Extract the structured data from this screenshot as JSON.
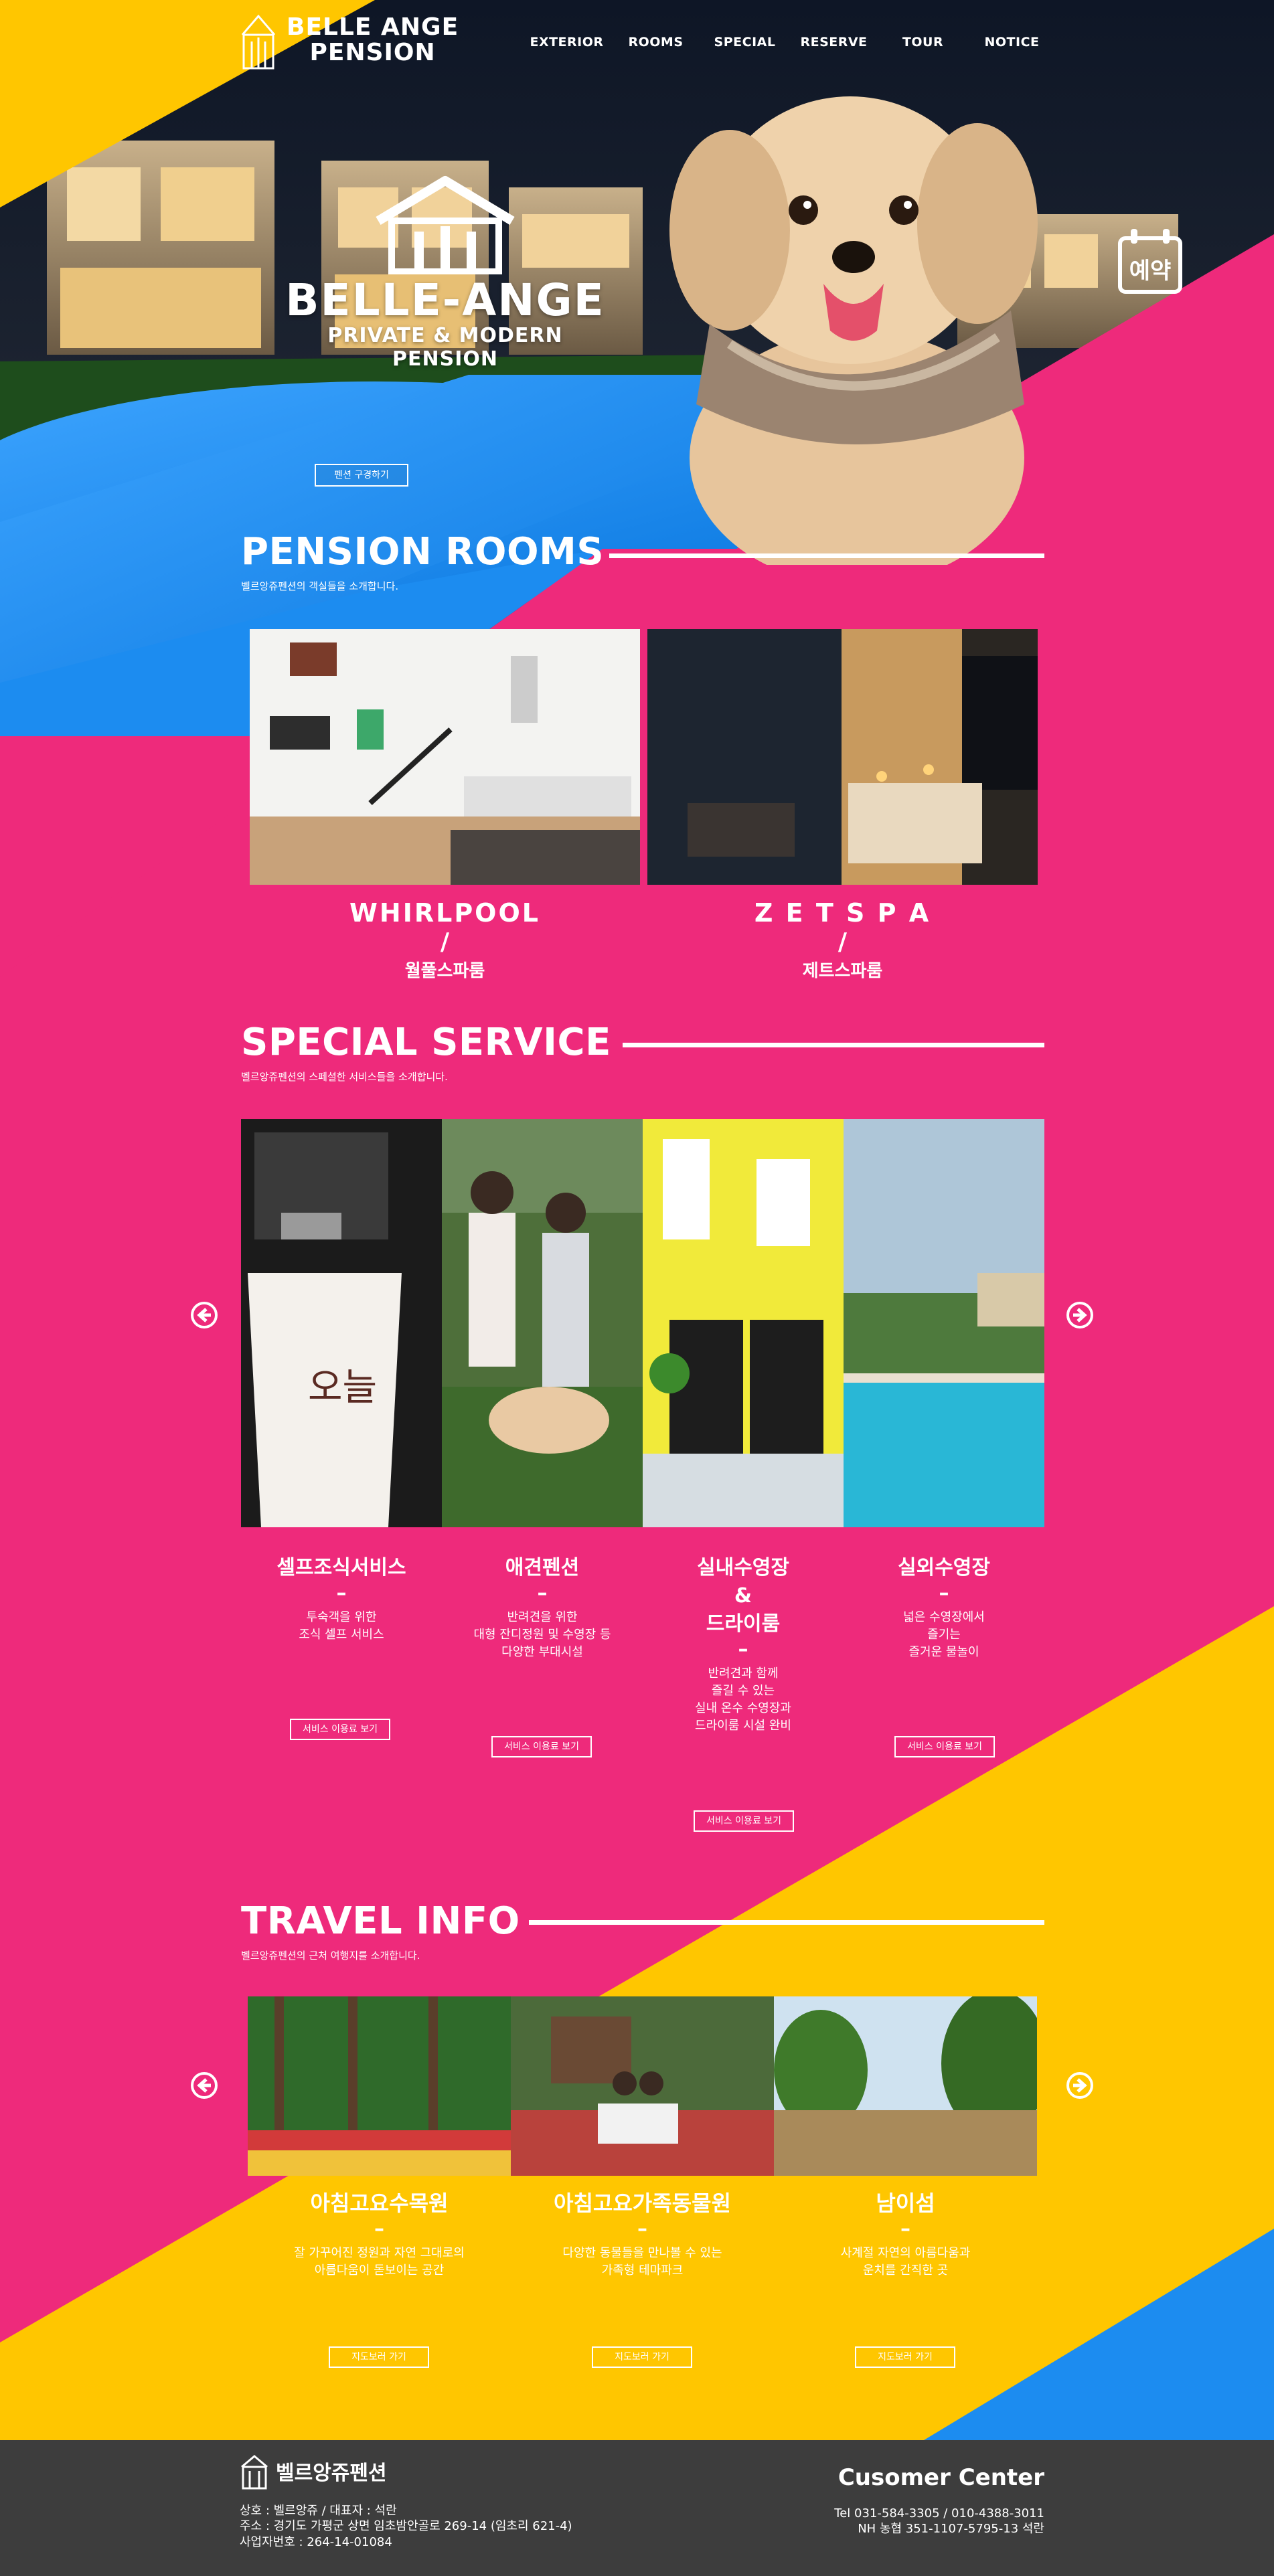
{
  "brand": {
    "line1": "BELLE ANGE",
    "line2": "PENSION"
  },
  "nav": {
    "items": [
      "EXTERIOR",
      "ROOMS",
      "SPECIAL",
      "RESERVE",
      "TOUR",
      "NOTICE"
    ]
  },
  "hero": {
    "title": "BELLE-ANGE",
    "subtitle": "PRIVATE & MODERN PENSION",
    "button": "펜션 구경하기",
    "reserve": "예약"
  },
  "rooms": {
    "title": "PENSION ROOMS",
    "desc": "벨르앙쥬펜션의 객실들을 소개합니다.",
    "items": [
      {
        "en": "WHIRLPOOL",
        "sep": "/",
        "ko": "월풀스파룸"
      },
      {
        "en": "Z E T S P A",
        "sep": "/",
        "ko": "제트스파룸"
      }
    ]
  },
  "special": {
    "title": "SPECIAL SERVICE",
    "desc": "벨르앙쥬펜션의 스페셜한 서비스들을 소개합니다.",
    "button": "서비스 이용료 보기",
    "items": [
      {
        "title": "셀프조식서비스",
        "title2": "",
        "title3": "",
        "dash": "–",
        "lines": [
          "투숙객을 위한",
          "조식 셀프 서비스"
        ]
      },
      {
        "title": "애견펜션",
        "title2": "",
        "title3": "",
        "dash": "–",
        "lines": [
          "반려견을 위한",
          "대형 잔디정원 및 수영장 등",
          "다양한 부대시설"
        ]
      },
      {
        "title": "실내수영장",
        "title2": "&",
        "title3": "드라이룸",
        "dash": "–",
        "lines": [
          "반려견과 함께",
          "즐길 수 있는",
          "실내 온수 수영장과",
          "드라이룸 시설 완비"
        ]
      },
      {
        "title": "실외수영장",
        "title2": "",
        "title3": "",
        "dash": "–",
        "lines": [
          "넓은 수영장에서",
          "즐기는",
          "즐거운 물놀이"
        ]
      }
    ]
  },
  "travel": {
    "title": "TRAVEL INFO",
    "desc": "벨르앙쥬펜션의 근처 여행지를 소개합니다.",
    "button": "지도보러 가기",
    "items": [
      {
        "title": "아침고요수목원",
        "dash": "–",
        "lines": [
          "잘 가꾸어진 정원과 자연 그대로의",
          "아름다움이 돋보이는 공간"
        ]
      },
      {
        "title": "아침고요가족동물원",
        "dash": "–",
        "lines": [
          "다양한 동물들을 만나볼 수 있는",
          "가족형 테마파크"
        ]
      },
      {
        "title": "남이섬",
        "dash": "–",
        "lines": [
          "사계절 자연의 아름다움과",
          "운치를 간직한 곳"
        ]
      }
    ]
  },
  "footer": {
    "logo": "벨르앙쥬펜션",
    "info": [
      "상호 : 벨르앙쥬 / 대표자 : 석란",
      "주소 : 경기도 가평군 상면 임초밤안골로 269-14 (임초리 621-4)",
      "사업자번호 : 264-14-01084"
    ],
    "cc_title": "Cusomer Center",
    "contact": [
      "Tel 031-584-3305 / 010-4388-3011",
      "NH 농협 351-1107-5795-13 석란"
    ]
  },
  "colors": {
    "pink": "#ee2a7b",
    "yellow": "#ffc600",
    "blue": "#1c8cf0",
    "dark": "#3d3d3d"
  }
}
